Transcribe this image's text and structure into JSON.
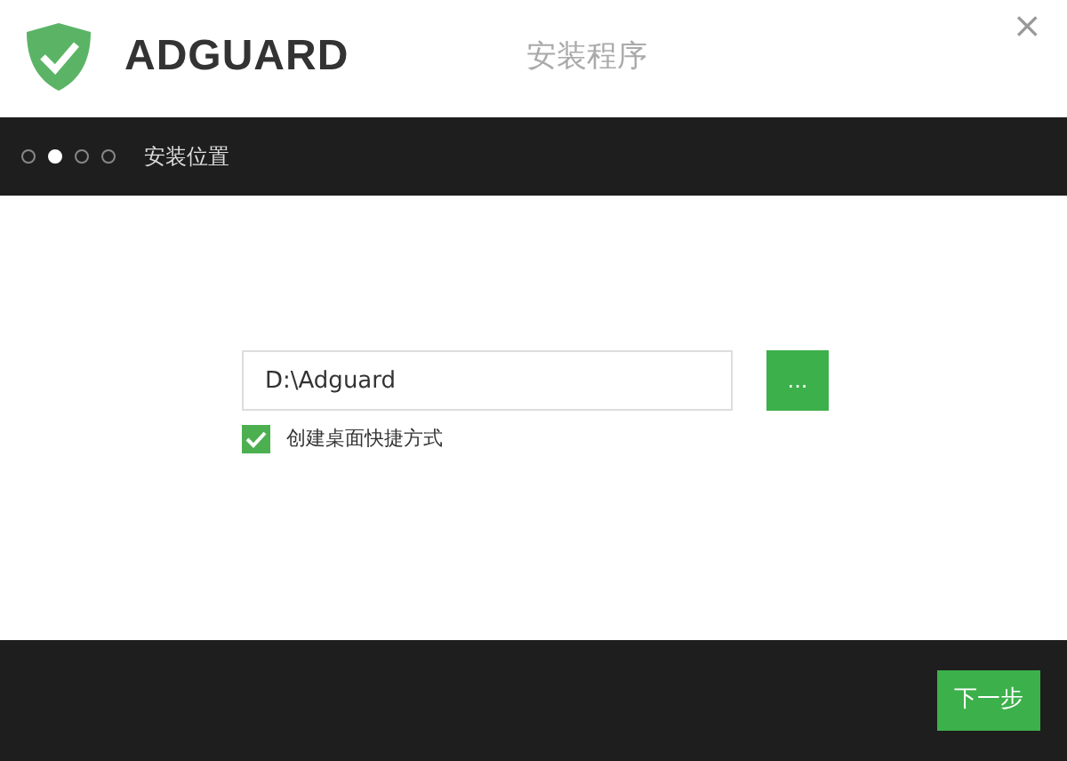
{
  "window": {
    "logo": "ADGUARD",
    "title": "安装程序",
    "close": "×"
  },
  "steps": [
    {
      "selected": false
    },
    {
      "selected": true
    },
    {
      "selected": false
    },
    {
      "selected": false
    }
  ],
  "step_title": "安装位置",
  "path_field": {
    "value": "D:\\Adguard"
  },
  "browse_button": "...",
  "shortcut": {
    "label": "创建桌面快捷方式",
    "checked": true
  },
  "next_button": "下一步"
}
